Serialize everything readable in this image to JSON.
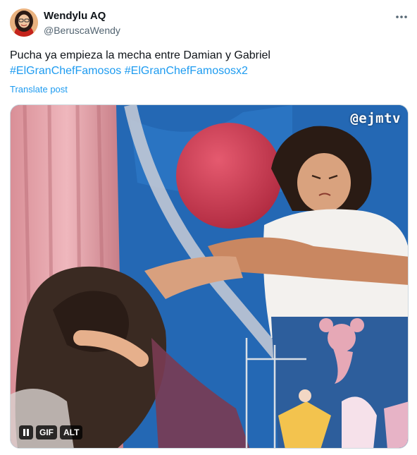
{
  "author": {
    "display_name": "Wendylu AQ",
    "handle": "@BeruscaWendy"
  },
  "tweet": {
    "text": "Pucha ya empieza la mecha entre Damian y Gabriel",
    "hashtags": [
      "#ElGranChefFamosos",
      "#ElGranChefFamososx2"
    ],
    "translate_label": "Translate post"
  },
  "media": {
    "watermark": "@ejmtv",
    "gif_label": "GIF",
    "alt_label": "ALT"
  },
  "icons": {
    "more": "more-horizontal-icon",
    "pause": "pause-icon"
  },
  "colors": {
    "link": "#1d9bf0",
    "secondary_text": "#536471",
    "primary_text": "#0f1419"
  }
}
